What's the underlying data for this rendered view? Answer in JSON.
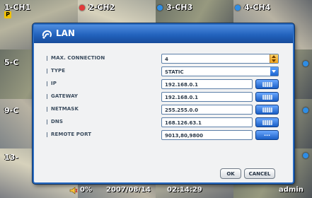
{
  "cameras": [
    {
      "label": "1-CH1",
      "dot": "red",
      "p_badge": "P"
    },
    {
      "label": "2-CH2",
      "dot": "red"
    },
    {
      "label": "3-CH3",
      "dot": "blue"
    },
    {
      "label": "4-CH4",
      "dot": "blue"
    },
    {
      "label": "5-C"
    },
    {
      "label": "9-C"
    },
    {
      "label": "13-"
    }
  ],
  "dialog": {
    "title": "LAN",
    "rows": [
      {
        "label": "MAX. CONNECTION",
        "value": "4",
        "control": "spinner"
      },
      {
        "label": "TYPE",
        "value": "STATIC",
        "control": "dropdown"
      },
      {
        "label": "IP",
        "value": "192.168.0.1",
        "control": "keyboard"
      },
      {
        "label": "GATEWAY",
        "value": "192.168.0.1",
        "control": "keyboard"
      },
      {
        "label": "NETMASK",
        "value": "255.255.0.0",
        "control": "keyboard"
      },
      {
        "label": "DNS",
        "value": "168.126.63.1",
        "control": "keyboard"
      },
      {
        "label": "REMOTE PORT",
        "value": "9013,80,9800",
        "control": "more",
        "button_text": "..."
      }
    ],
    "ok_label": "OK",
    "cancel_label": "CANCEL"
  },
  "status": {
    "volume": "0%",
    "date": "2007/08/14",
    "time": "02:14:29",
    "user": "admin"
  },
  "colors": {
    "title_bar": "#2363bd",
    "dialog_bg": "#f1f2f3",
    "accent_orange": "#f0a21a",
    "rec_dot": "#e23a3a",
    "live_dot": "#2f8de4"
  }
}
